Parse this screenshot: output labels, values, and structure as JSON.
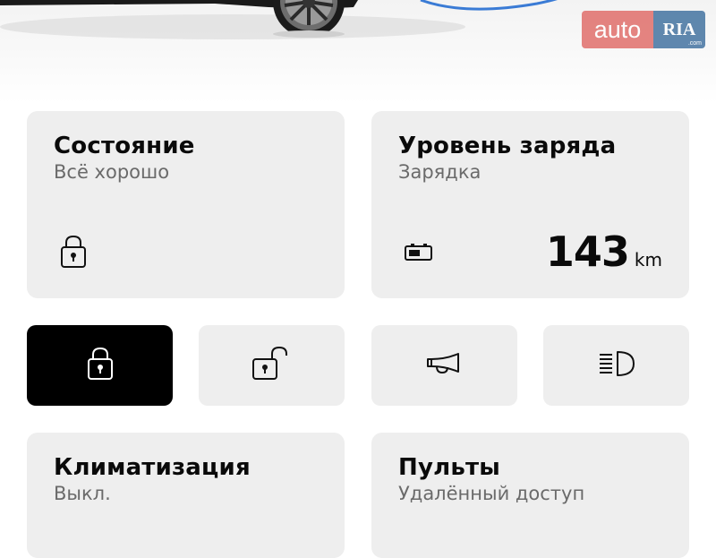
{
  "watermark": {
    "part1": "auto",
    "part2": "RIA",
    "part3": ".com"
  },
  "cards": {
    "status": {
      "title": "Состояние",
      "subtitle": "Всё хорошо",
      "icon": "lock-closed-icon"
    },
    "charge": {
      "title": "Уровень заряда",
      "subtitle": "Зарядка",
      "icon": "battery-icon",
      "range_value": "143",
      "range_unit": "km"
    },
    "climate": {
      "title": "Климатизация",
      "subtitle": "Выкл."
    },
    "remotes": {
      "title": "Пульты",
      "subtitle": "Удалённый доступ"
    }
  },
  "actions": [
    {
      "icon": "lock-icon",
      "active": true
    },
    {
      "icon": "unlock-icon",
      "active": false
    },
    {
      "icon": "horn-icon",
      "active": false
    },
    {
      "icon": "headlights-icon",
      "active": false
    }
  ],
  "colors": {
    "card_bg": "#eeeeee",
    "active_bg": "#000000",
    "subtitle": "#6a6a6a",
    "cable": "#3a7bd5"
  }
}
